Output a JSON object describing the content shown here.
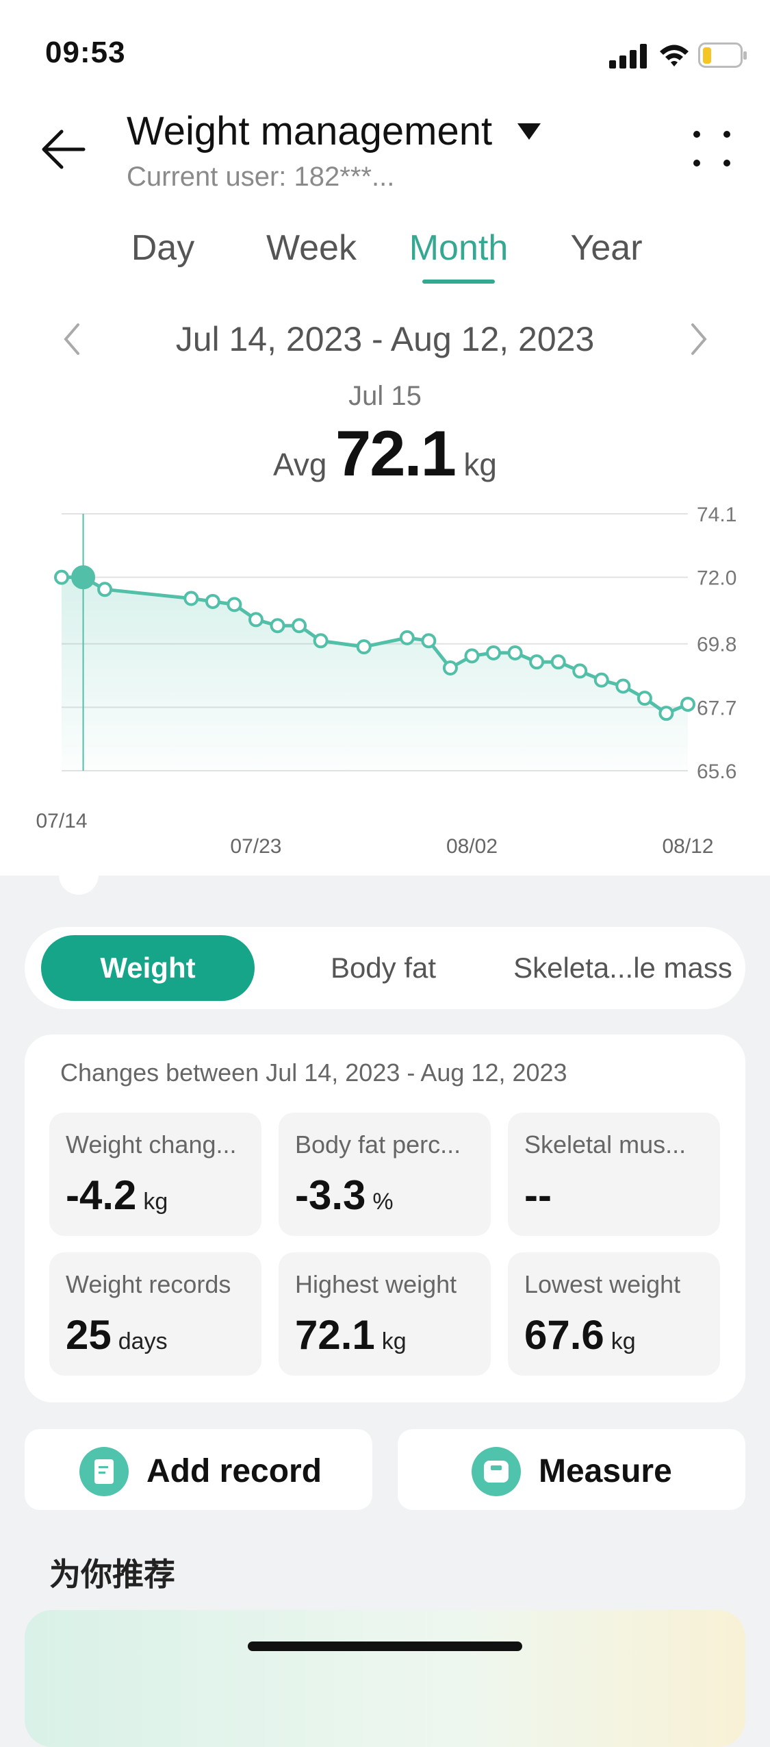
{
  "status_bar": {
    "time": "09:53"
  },
  "header": {
    "title": "Weight management",
    "subtitle": "Current user: 182***..."
  },
  "tabs": [
    {
      "label": "Day",
      "active": false
    },
    {
      "label": "Week",
      "active": false
    },
    {
      "label": "Month",
      "active": true
    },
    {
      "label": "Year",
      "active": false
    }
  ],
  "date_range": "Jul 14, 2023 - Aug 12, 2023",
  "selected": {
    "date": "Jul 15",
    "avg_label": "Avg",
    "avg_value": "72.1",
    "unit": "kg"
  },
  "chart_data": {
    "type": "line",
    "y_ticks": [
      "74.1",
      "72.0",
      "69.8",
      "67.7",
      "65.6"
    ],
    "x_ticks": [
      "07/14",
      "07/23",
      "08/02",
      "08/12"
    ],
    "ylim": [
      65.6,
      74.1
    ],
    "grid": true,
    "series": [
      {
        "points": [
          [
            "07/14",
            72.0
          ],
          [
            "07/15",
            72.0
          ],
          [
            "07/16",
            71.6
          ],
          [
            "07/20",
            71.3
          ],
          [
            "07/21",
            71.2
          ],
          [
            "07/22",
            71.1
          ],
          [
            "07/23",
            70.6
          ],
          [
            "07/24",
            70.4
          ],
          [
            "07/25",
            70.4
          ],
          [
            "07/26",
            69.9
          ],
          [
            "07/28",
            69.7
          ],
          [
            "07/30",
            70.0
          ],
          [
            "07/31",
            69.9
          ],
          [
            "08/01",
            69.0
          ],
          [
            "08/02",
            69.4
          ],
          [
            "08/03",
            69.5
          ],
          [
            "08/04",
            69.5
          ],
          [
            "08/05",
            69.2
          ],
          [
            "08/06",
            69.2
          ],
          [
            "08/07",
            68.9
          ],
          [
            "08/08",
            68.6
          ],
          [
            "08/09",
            68.4
          ],
          [
            "08/10",
            68.0
          ],
          [
            "08/11",
            67.5
          ],
          [
            "08/12",
            67.8
          ]
        ]
      }
    ],
    "selected_point": "07/15",
    "line_color": "#52bfa8"
  },
  "metric_tabs": [
    "Weight",
    "Body fat",
    "Skeleta...le mass"
  ],
  "changes": {
    "title": "Changes between Jul 14, 2023 - Aug 12, 2023",
    "stats": [
      {
        "label": "Weight chang...",
        "value": "-4.2",
        "unit": "kg"
      },
      {
        "label": "Body fat perc...",
        "value": "-3.3",
        "unit": "%"
      },
      {
        "label": "Skeletal mus...",
        "value": "--",
        "unit": ""
      },
      {
        "label": "Weight records",
        "value": "25",
        "unit": "days"
      },
      {
        "label": "Highest weight",
        "value": "72.1",
        "unit": "kg"
      },
      {
        "label": "Lowest weight",
        "value": "67.6",
        "unit": "kg"
      }
    ]
  },
  "actions": {
    "add_record": "Add record",
    "measure": "Measure"
  },
  "recommend": {
    "title": "为你推荐"
  },
  "colors": {
    "accent": "#16a589",
    "line": "#52bfa8",
    "tab_active": "#35a892"
  }
}
